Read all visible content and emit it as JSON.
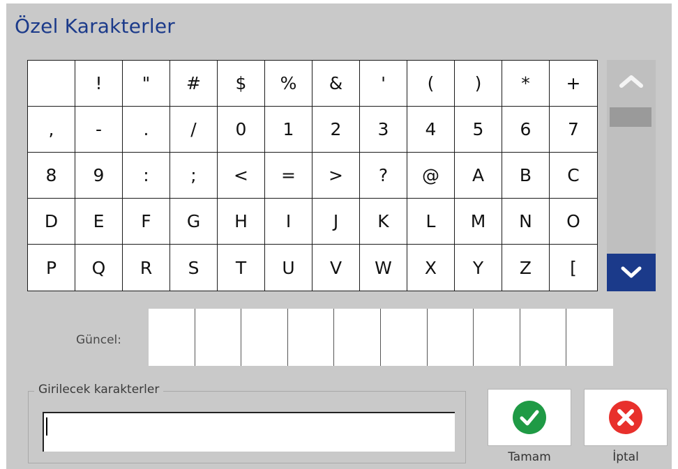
{
  "dialog": {
    "title": "Özel Karakterler"
  },
  "grid": {
    "characters": [
      "",
      "!",
      "\"",
      "#",
      "$",
      "%",
      "&",
      "'",
      "(",
      ")",
      "*",
      "+",
      ",",
      "-",
      ".",
      "/",
      "0",
      "1",
      "2",
      "3",
      "4",
      "5",
      "6",
      "7",
      "8",
      "9",
      ":",
      ";",
      "<",
      "=",
      ">",
      "?",
      "@",
      "A",
      "B",
      "C",
      "D",
      "E",
      "F",
      "G",
      "H",
      "I",
      "J",
      "K",
      "L",
      "M",
      "N",
      "O",
      "P",
      "Q",
      "R",
      "S",
      "T",
      "U",
      "V",
      "W",
      "X",
      "Y",
      "Z",
      "["
    ]
  },
  "scrollbar": {
    "up_icon": "chevron-up-icon",
    "down_icon": "chevron-down-icon",
    "accent_color": "#1b3a8a"
  },
  "current": {
    "label": "Güncel:",
    "slots": [
      "",
      "",
      "",
      "",
      "",
      "",
      "",
      "",
      "",
      ""
    ]
  },
  "input": {
    "legend": "Girilecek karakterler",
    "value": ""
  },
  "buttons": {
    "ok_label": "Tamam",
    "ok_color": "#1f9a45",
    "cancel_label": "İptal",
    "cancel_color": "#e8302c"
  }
}
